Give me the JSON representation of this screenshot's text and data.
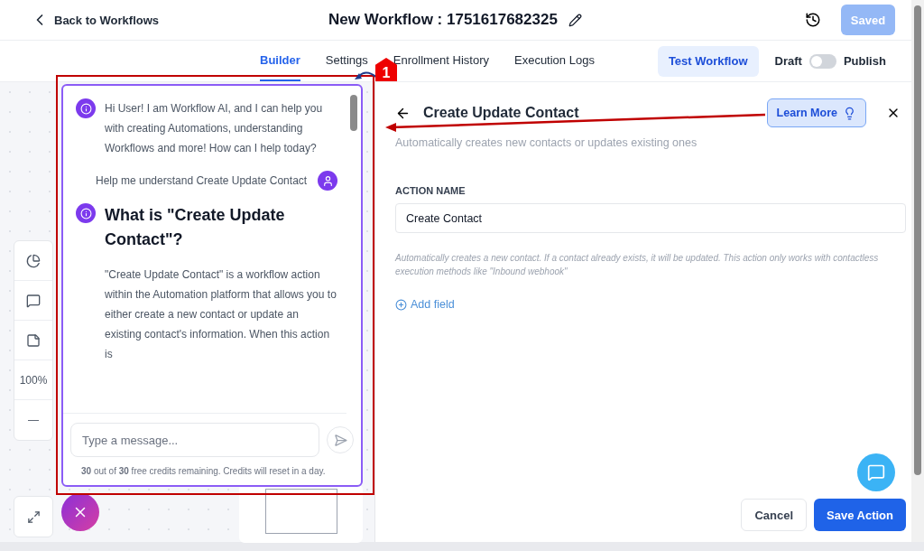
{
  "header": {
    "back": "Back to Workflows",
    "title": "New Workflow : 1751617682325",
    "saved_button": "Saved"
  },
  "tabs": [
    {
      "label": "Builder",
      "selected": true
    },
    {
      "label": "Settings",
      "selected": false
    },
    {
      "label": "Enrollment History",
      "selected": false
    },
    {
      "label": "Execution Logs",
      "selected": false
    }
  ],
  "test_button": "Test Workflow",
  "publish_toggle": {
    "off_label": "Draft",
    "on_label": "Publish",
    "on": false
  },
  "canvas": {
    "zoom": "100%",
    "minus": "—"
  },
  "chat": {
    "messages": [
      {
        "kind": "bot",
        "text": "Hi User! I am Workflow AI, and I can help you with creating Automations, understanding Workflows and more! How can I help today?"
      },
      {
        "kind": "user",
        "text": "Help me understand Create Update Contact"
      },
      {
        "kind": "heading",
        "text": "What is \"Create Update Contact\"?"
      },
      {
        "kind": "body",
        "text": "\"Create Update Contact\" is a workflow action within the Automation platform that allows you to either create a new contact or update an existing contact's information. When this action is"
      }
    ],
    "input_placeholder": "Type a message...",
    "credits": "**30** out of **30** free credits remaining. Credits will reset in a day."
  },
  "panel": {
    "title": "Create Update Contact",
    "subtitle": "Automatically creates new contacts or updates existing ones",
    "learn_more": "Learn More",
    "field_label": "ACTION NAME",
    "field_value": "Create Contact",
    "hint": "Automatically creates a new contact. If a contact already exists, it will be updated. This action only works with contactless execution methods like \"Inbound webhook\"",
    "add_field": "Add field",
    "cancel": "Cancel",
    "save": "Save Action"
  },
  "annotation": {
    "number": "1"
  }
}
